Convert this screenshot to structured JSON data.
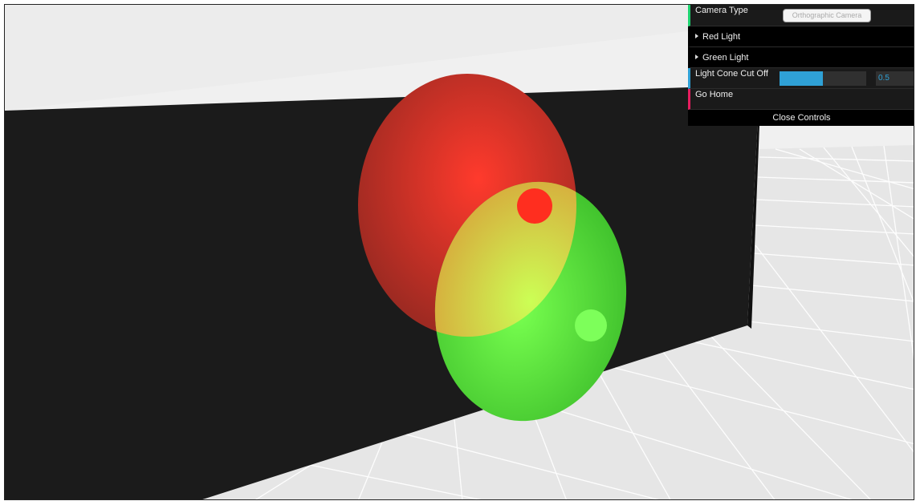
{
  "gui": {
    "camera_type_label": "Camera Type",
    "camera_type_value": "Orthographic Camera",
    "red_light_label": "Red Light",
    "green_light_label": "Green Light",
    "cone_cutoff_label": "Light Cone Cut Off",
    "cone_cutoff_value": "0.5",
    "cone_cutoff_fraction": 0.5,
    "go_home_label": "Go Home",
    "close_controls_label": "Close Controls"
  },
  "scene": {
    "red_light_color": "#ff3b2f",
    "green_light_color": "#6bff4a",
    "wall_color": "#1b1b1b",
    "floor_color": "#f2f2f2",
    "ceiling_color": "#ececec"
  },
  "icons": {
    "folder_caret": "caret-right-icon"
  }
}
